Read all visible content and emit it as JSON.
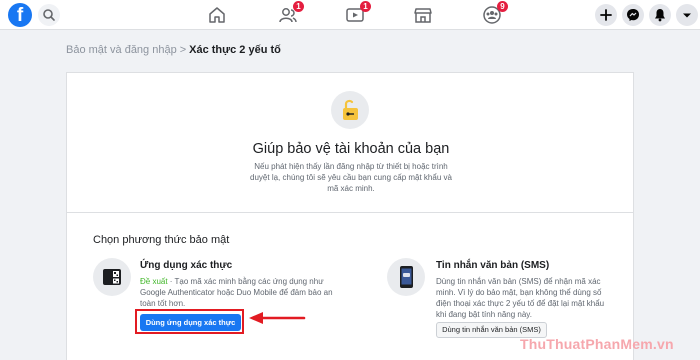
{
  "nav": {
    "logo_letter": "f",
    "badges": {
      "friends": "1",
      "watch": "1",
      "groups": "9"
    }
  },
  "breadcrumb": {
    "parent": "Bảo mật và đăng nhập",
    "separator": ">",
    "current": "Xác thực 2 yếu tố"
  },
  "hero": {
    "title": "Giúp bảo vệ tài khoản của bạn",
    "description": "Nếu phát hiện thấy lần đăng nhập từ thiết bị hoặc trình duyệt lạ, chúng tôi sẽ yêu cầu bạn cung cấp mật khẩu và mã xác minh."
  },
  "section_title": "Chọn phương thức bảo mật",
  "methods": [
    {
      "title": "Ứng dụng xác thực",
      "recommended": "Đề xuất",
      "description": " · Tạo mã xác minh bằng các ứng dụng như Google Authenticator hoặc Duo Mobile để đảm bảo an toàn tốt hơn.",
      "button": "Dùng ứng dụng xác thực"
    },
    {
      "title": "Tin nhắn văn bản (SMS)",
      "description": "Dùng tin nhắn văn bản (SMS) để nhận mã xác minh. Vì lý do bảo mật, bạn không thể dùng số điện thoại xác thực 2 yếu tố để đặt lại mật khẩu khi đang bật tính năng này.",
      "button": "Dùng tin nhắn văn bản (SMS)"
    }
  ],
  "watermark": "ThuThuatPhanMem.vn",
  "colors": {
    "accent": "#1877f2",
    "highlight": "#e21b22",
    "recommended": "#42b72a",
    "badge": "#e41e3f"
  },
  "icons": [
    "facebook-logo",
    "search-icon",
    "home-icon",
    "friends-icon",
    "watch-icon",
    "marketplace-icon",
    "groups-icon",
    "plus-icon",
    "messenger-icon",
    "bell-icon",
    "chevron-down-icon",
    "padlock-icon",
    "qr-phone-icon",
    "sms-phone-icon",
    "arrow-icon"
  ]
}
